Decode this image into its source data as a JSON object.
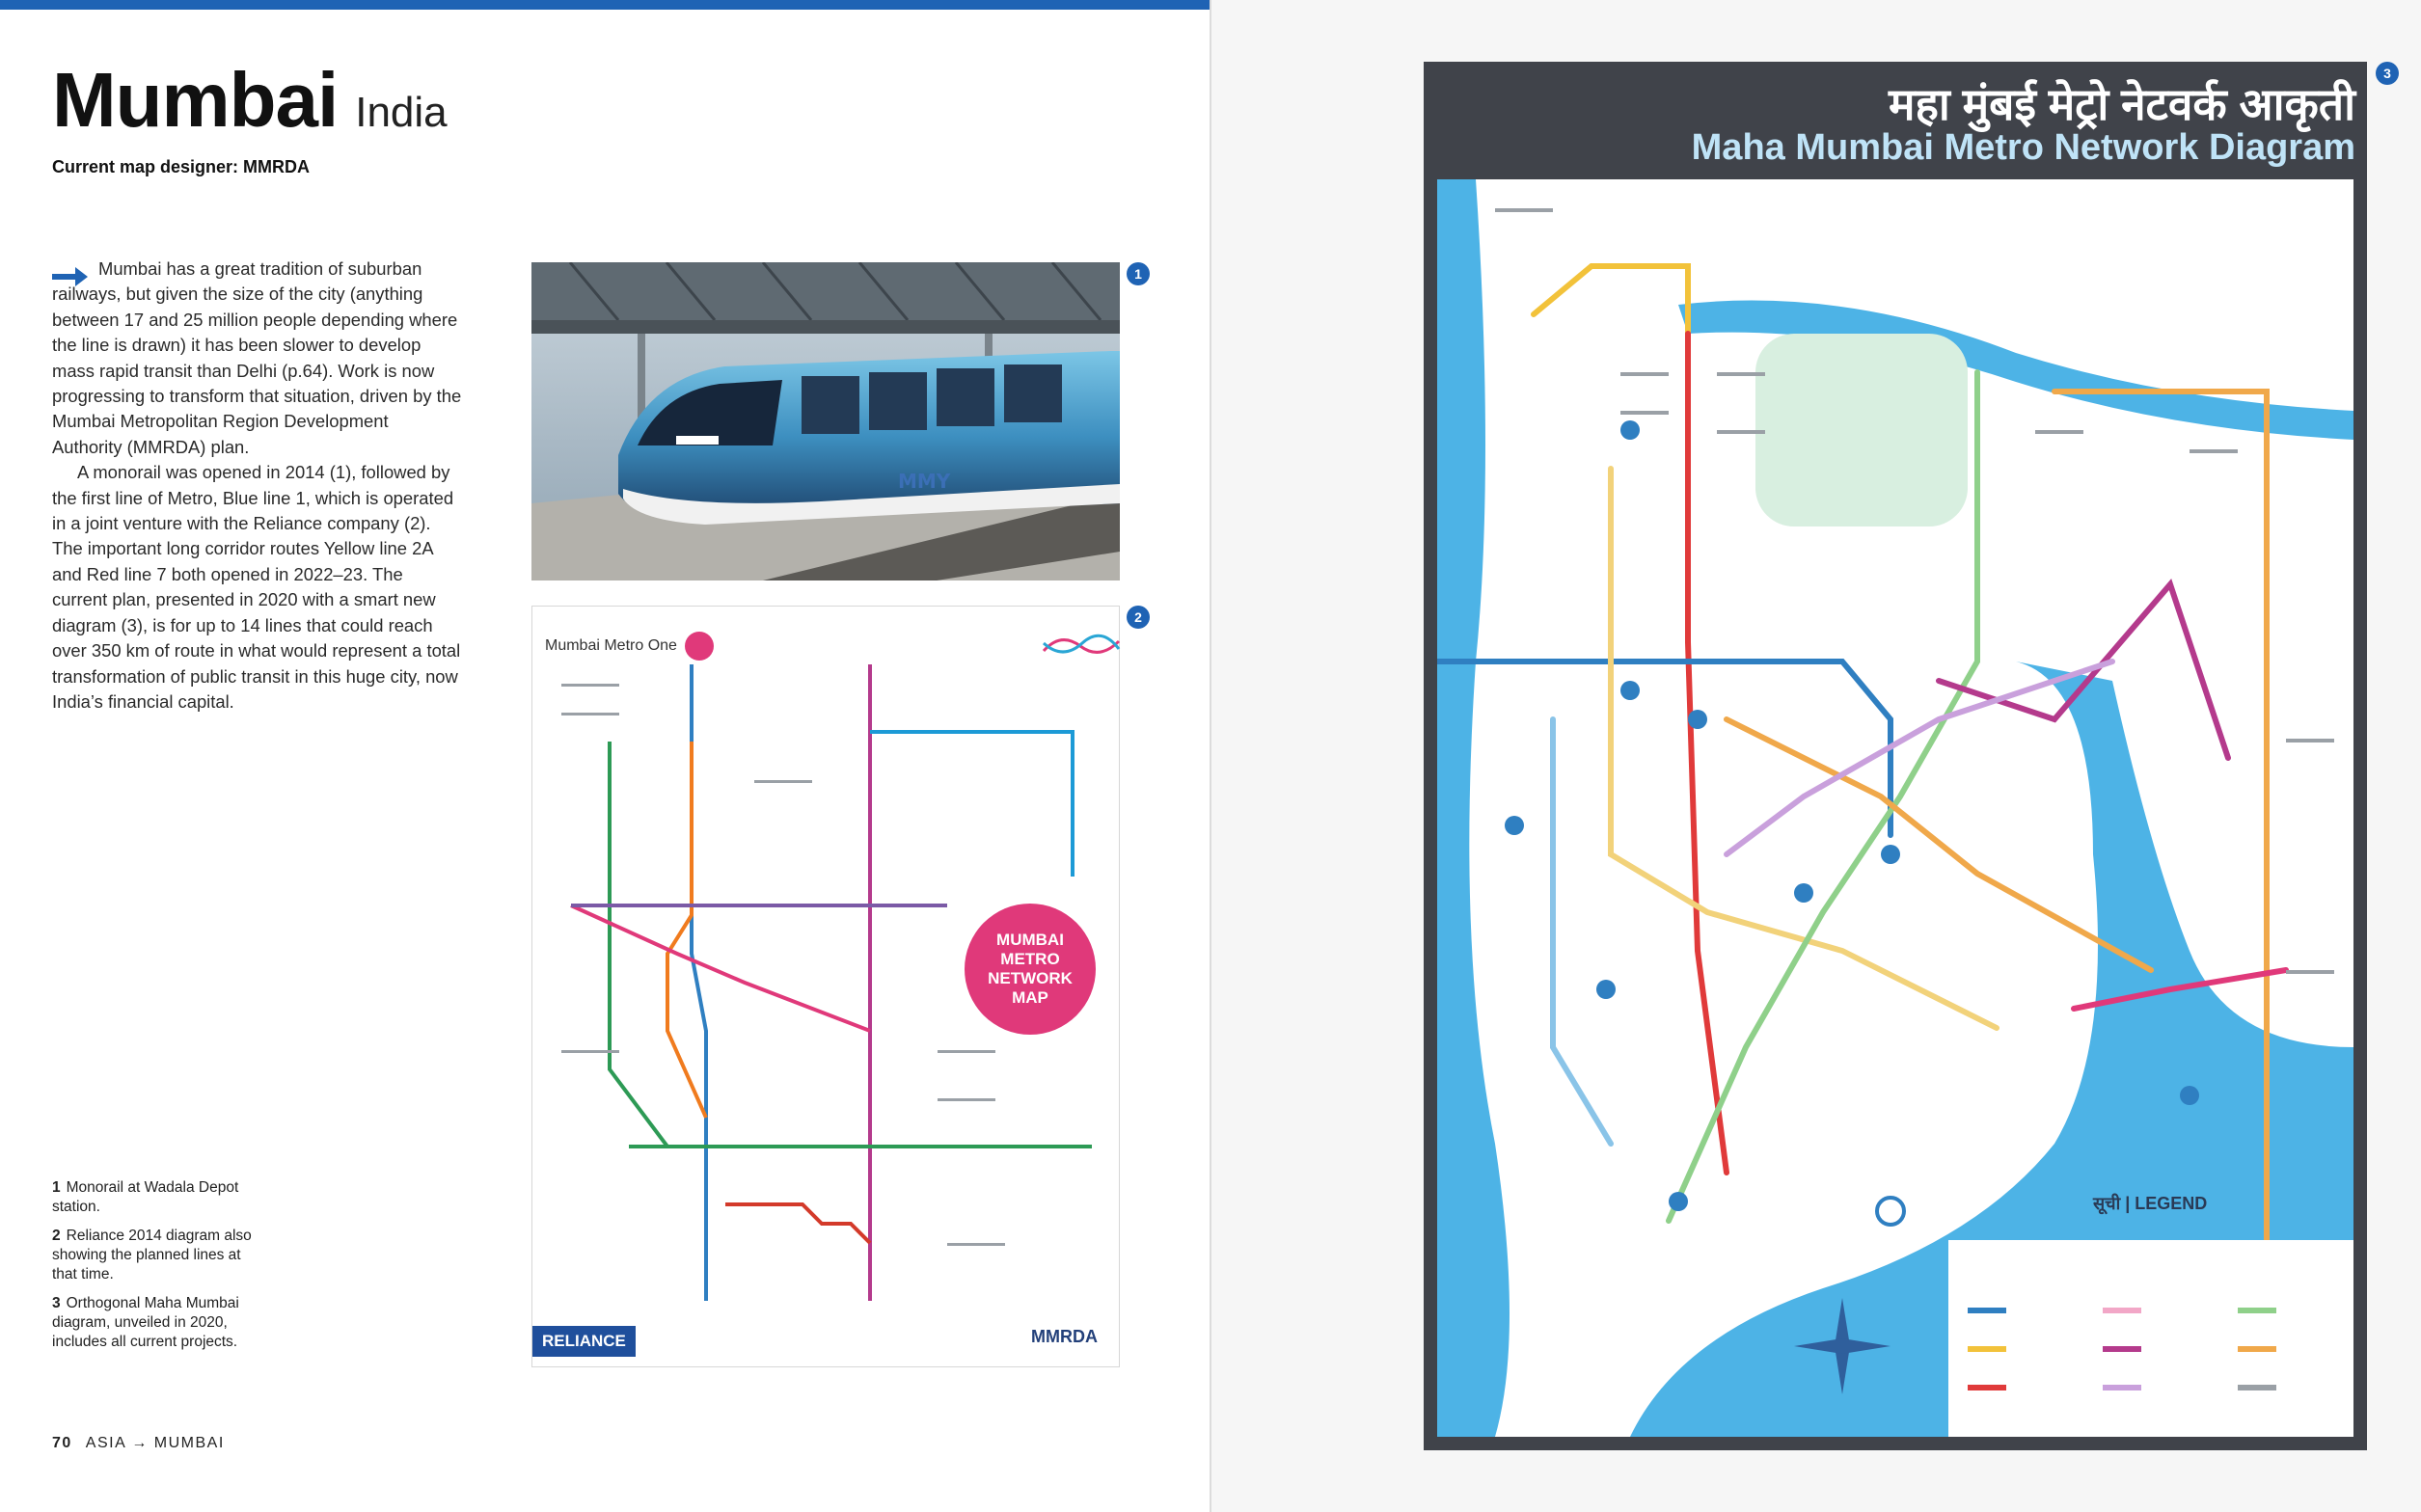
{
  "header": {
    "city": "Mumbai",
    "country": "India",
    "designer": "Current map designer: MMRDA"
  },
  "body": {
    "p1": "Mumbai has a great tradition of suburban railways, but given the size of the city (anything between 17 and 25 million people depending where the line is drawn) it has been slower to develop mass rapid transit than Delhi (p.64). Work is now progressing to transform that situation, driven by the Mumbai Metropolitan Region Development Authority (MMRDA) plan.",
    "p2": "A monorail was opened in 2014 (1), followed by the first line of Metro, Blue line 1, which is operated in a joint venture with the Reliance company (2). The important long corridor routes Yellow line 2A and Red line 7 both opened in 2022–23. The current plan, presented in 2020 with a smart new diagram (3), is for up to 14 lines that could reach over 350 km of route in what would represent a total transformation of public transit in this huge city, now India’s financial capital."
  },
  "badges": {
    "b1": "1",
    "b2": "2",
    "b3": "3"
  },
  "captions": [
    {
      "num": "1",
      "text": "Monorail at Wadala Depot station."
    },
    {
      "num": "2",
      "text": "Reliance 2014 diagram also showing the planned lines at that time."
    },
    {
      "num": "3",
      "text": "Orthogonal Maha Mumbai diagram, unveiled in 2020, includes all current projects."
    }
  ],
  "footer": {
    "page": "70",
    "section": "ASIA → MUMBAI"
  },
  "figure2": {
    "title": "Mumbai Metro One",
    "badge": "MUMBAI METRO NETWORK MAP",
    "logo_left": "RELIANCE",
    "logo_right": "MMRDA"
  },
  "figure3": {
    "title_hindi": "महा मुंबई मेट्रो नेटवर्क आकृती",
    "title_english": "Maha Mumbai Metro Network Diagram",
    "legend": "सूची | LEGEND"
  },
  "colors": {
    "accent": "#1f63b4",
    "metro_one_magenta": "#e0397a",
    "map_water": "#4db3e6"
  }
}
